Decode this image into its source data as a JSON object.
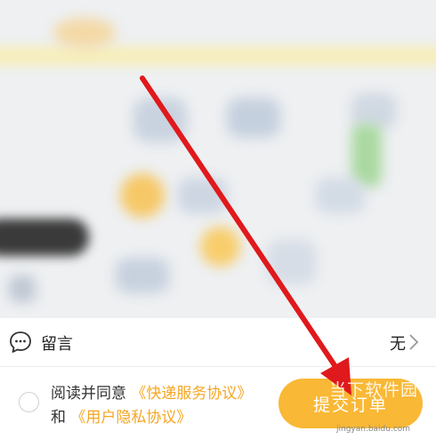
{
  "message_row": {
    "label": "留言",
    "value": "无",
    "icon": "chat-bubble-icon"
  },
  "agreement": {
    "prefix": "阅读并同意",
    "link_service": "《快递服务协议》",
    "conjunction": "和",
    "link_privacy": "《用户隐私协议》"
  },
  "submit_label": "提交订单",
  "watermark": {
    "title": "当下软件园",
    "url": "jingyan.baidu.com"
  },
  "colors": {
    "accent": "#f9b835",
    "link": "#f5a623",
    "arrow": "#e0191c"
  }
}
